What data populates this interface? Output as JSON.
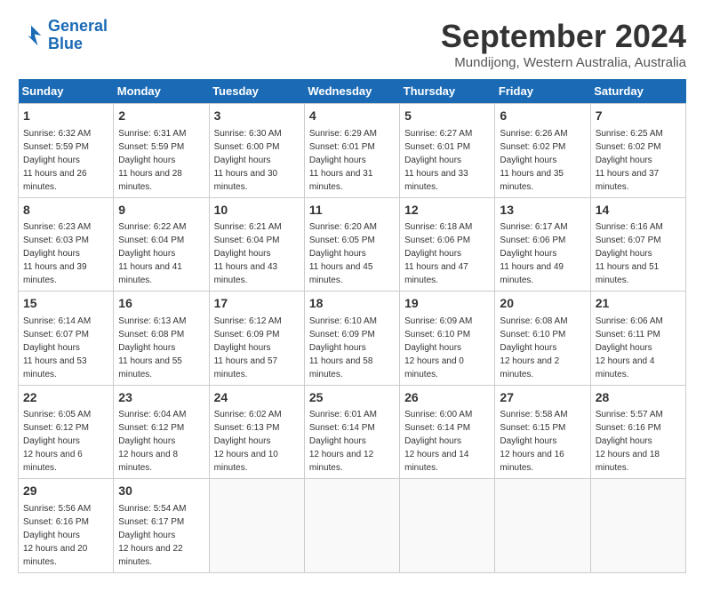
{
  "logo": {
    "line1": "General",
    "line2": "Blue"
  },
  "title": "September 2024",
  "subtitle": "Mundijong, Western Australia, Australia",
  "weekdays": [
    "Sunday",
    "Monday",
    "Tuesday",
    "Wednesday",
    "Thursday",
    "Friday",
    "Saturday"
  ],
  "weeks": [
    [
      {
        "day": "1",
        "sunrise": "6:32 AM",
        "sunset": "5:59 PM",
        "daylight": "11 hours and 26 minutes."
      },
      {
        "day": "2",
        "sunrise": "6:31 AM",
        "sunset": "5:59 PM",
        "daylight": "11 hours and 28 minutes."
      },
      {
        "day": "3",
        "sunrise": "6:30 AM",
        "sunset": "6:00 PM",
        "daylight": "11 hours and 30 minutes."
      },
      {
        "day": "4",
        "sunrise": "6:29 AM",
        "sunset": "6:01 PM",
        "daylight": "11 hours and 31 minutes."
      },
      {
        "day": "5",
        "sunrise": "6:27 AM",
        "sunset": "6:01 PM",
        "daylight": "11 hours and 33 minutes."
      },
      {
        "day": "6",
        "sunrise": "6:26 AM",
        "sunset": "6:02 PM",
        "daylight": "11 hours and 35 minutes."
      },
      {
        "day": "7",
        "sunrise": "6:25 AM",
        "sunset": "6:02 PM",
        "daylight": "11 hours and 37 minutes."
      }
    ],
    [
      {
        "day": "8",
        "sunrise": "6:23 AM",
        "sunset": "6:03 PM",
        "daylight": "11 hours and 39 minutes."
      },
      {
        "day": "9",
        "sunrise": "6:22 AM",
        "sunset": "6:04 PM",
        "daylight": "11 hours and 41 minutes."
      },
      {
        "day": "10",
        "sunrise": "6:21 AM",
        "sunset": "6:04 PM",
        "daylight": "11 hours and 43 minutes."
      },
      {
        "day": "11",
        "sunrise": "6:20 AM",
        "sunset": "6:05 PM",
        "daylight": "11 hours and 45 minutes."
      },
      {
        "day": "12",
        "sunrise": "6:18 AM",
        "sunset": "6:06 PM",
        "daylight": "11 hours and 47 minutes."
      },
      {
        "day": "13",
        "sunrise": "6:17 AM",
        "sunset": "6:06 PM",
        "daylight": "11 hours and 49 minutes."
      },
      {
        "day": "14",
        "sunrise": "6:16 AM",
        "sunset": "6:07 PM",
        "daylight": "11 hours and 51 minutes."
      }
    ],
    [
      {
        "day": "15",
        "sunrise": "6:14 AM",
        "sunset": "6:07 PM",
        "daylight": "11 hours and 53 minutes."
      },
      {
        "day": "16",
        "sunrise": "6:13 AM",
        "sunset": "6:08 PM",
        "daylight": "11 hours and 55 minutes."
      },
      {
        "day": "17",
        "sunrise": "6:12 AM",
        "sunset": "6:09 PM",
        "daylight": "11 hours and 57 minutes."
      },
      {
        "day": "18",
        "sunrise": "6:10 AM",
        "sunset": "6:09 PM",
        "daylight": "11 hours and 58 minutes."
      },
      {
        "day": "19",
        "sunrise": "6:09 AM",
        "sunset": "6:10 PM",
        "daylight": "12 hours and 0 minutes."
      },
      {
        "day": "20",
        "sunrise": "6:08 AM",
        "sunset": "6:10 PM",
        "daylight": "12 hours and 2 minutes."
      },
      {
        "day": "21",
        "sunrise": "6:06 AM",
        "sunset": "6:11 PM",
        "daylight": "12 hours and 4 minutes."
      }
    ],
    [
      {
        "day": "22",
        "sunrise": "6:05 AM",
        "sunset": "6:12 PM",
        "daylight": "12 hours and 6 minutes."
      },
      {
        "day": "23",
        "sunrise": "6:04 AM",
        "sunset": "6:12 PM",
        "daylight": "12 hours and 8 minutes."
      },
      {
        "day": "24",
        "sunrise": "6:02 AM",
        "sunset": "6:13 PM",
        "daylight": "12 hours and 10 minutes."
      },
      {
        "day": "25",
        "sunrise": "6:01 AM",
        "sunset": "6:14 PM",
        "daylight": "12 hours and 12 minutes."
      },
      {
        "day": "26",
        "sunrise": "6:00 AM",
        "sunset": "6:14 PM",
        "daylight": "12 hours and 14 minutes."
      },
      {
        "day": "27",
        "sunrise": "5:58 AM",
        "sunset": "6:15 PM",
        "daylight": "12 hours and 16 minutes."
      },
      {
        "day": "28",
        "sunrise": "5:57 AM",
        "sunset": "6:16 PM",
        "daylight": "12 hours and 18 minutes."
      }
    ],
    [
      {
        "day": "29",
        "sunrise": "5:56 AM",
        "sunset": "6:16 PM",
        "daylight": "12 hours and 20 minutes."
      },
      {
        "day": "30",
        "sunrise": "5:54 AM",
        "sunset": "6:17 PM",
        "daylight": "12 hours and 22 minutes."
      },
      null,
      null,
      null,
      null,
      null
    ]
  ]
}
